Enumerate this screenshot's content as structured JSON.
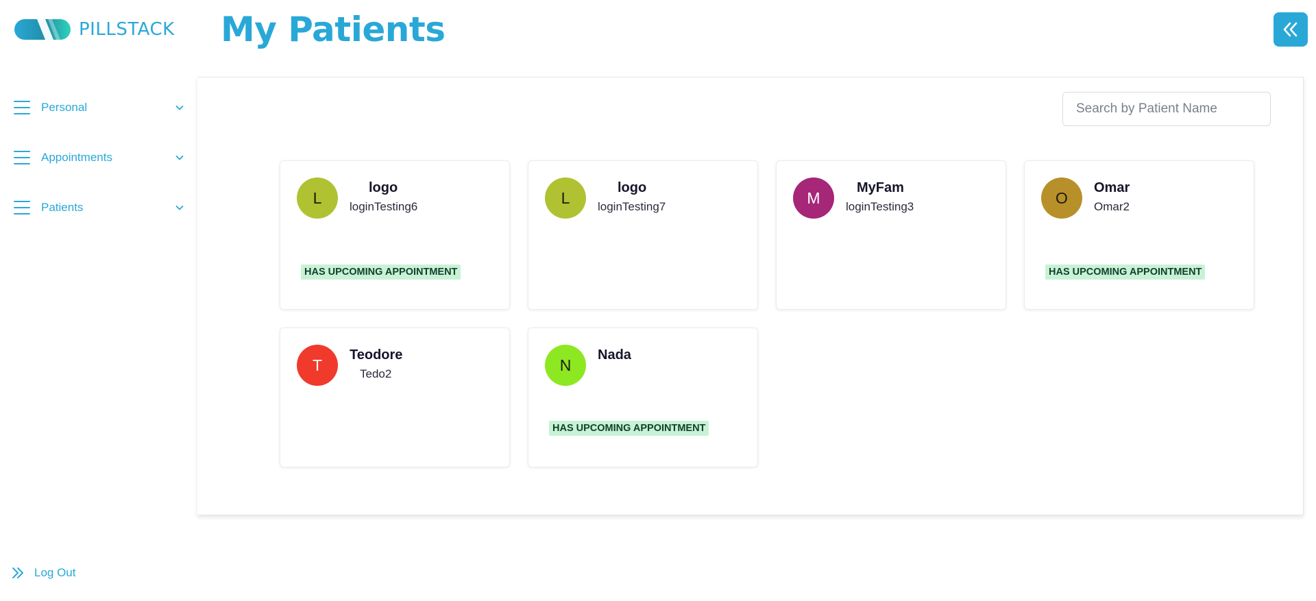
{
  "brand": {
    "name": "PILLSTACK"
  },
  "colors": {
    "accent": "#29a8d8",
    "badge_bg": "#c8f2d6",
    "badge_text": "#13402a"
  },
  "sidebar": {
    "items": [
      {
        "label": "Personal",
        "icon": "menu-icon"
      },
      {
        "label": "Appointments",
        "icon": "menu-icon"
      },
      {
        "label": "Patients",
        "icon": "menu-icon"
      }
    ],
    "logout_label": "Log Out"
  },
  "header": {
    "title": "My Patients",
    "collapse_icon": "double-chevron-left-icon"
  },
  "search": {
    "placeholder": "Search by Patient Name",
    "value": ""
  },
  "patients": [
    {
      "initial": "L",
      "name": "logo",
      "username": "loginTesting6",
      "color": "#b0c232",
      "badge": "HAS UPCOMING APPOINTMENT"
    },
    {
      "initial": "L",
      "name": "logo",
      "username": "loginTesting7",
      "color": "#b0c232",
      "badge": ""
    },
    {
      "initial": "M",
      "name": "MyFam",
      "username": "loginTesting3",
      "color": "#a62678",
      "badge": ""
    },
    {
      "initial": "O",
      "name": "Omar",
      "username": "Omar2",
      "color": "#b8902a",
      "badge": "HAS UPCOMING APPOINTMENT"
    },
    {
      "initial": "T",
      "name": "Teodore",
      "username": "Tedo2",
      "color": "#f03a2c",
      "badge": ""
    },
    {
      "initial": "N",
      "name": "Nada",
      "username": "",
      "color": "#8de822",
      "badge": "HAS UPCOMING APPOINTMENT"
    }
  ]
}
